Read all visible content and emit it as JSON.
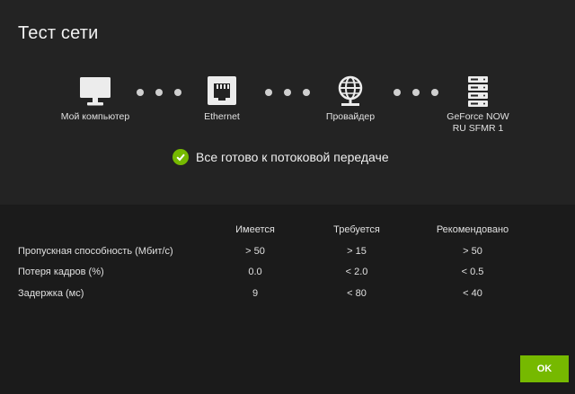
{
  "dialog": {
    "title": "Тест сети"
  },
  "path": {
    "nodes": [
      {
        "label": "Мой компьютер",
        "icon": "monitor-icon"
      },
      {
        "label": "Ethernet",
        "icon": "ethernet-port-icon"
      },
      {
        "label": "Провайдер",
        "icon": "globe-network-icon"
      },
      {
        "label": "GeForce NOW\nRU SFMR 1",
        "icon": "server-icon"
      }
    ]
  },
  "status": {
    "text": "Все готово к потоковой передаче",
    "icon": "check-circle-icon",
    "color": "#76b900"
  },
  "table": {
    "headers": [
      "Имеется",
      "Требуется",
      "Рекомендовано"
    ],
    "rows": [
      {
        "label": "Пропускная способность (Мбит/с)",
        "values": [
          "> 50",
          "> 15",
          "> 50"
        ]
      },
      {
        "label": "Потеря кадров (%)",
        "values": [
          "0.0",
          "< 2.0",
          "< 0.5"
        ]
      },
      {
        "label": "Задержка (мс)",
        "values": [
          "9",
          "< 80",
          "< 40"
        ]
      }
    ]
  },
  "footer": {
    "ok_label": "OK"
  },
  "colors": {
    "accent": "#76b900",
    "panel_top": "#232323",
    "panel_bottom": "#1b1b1b"
  }
}
